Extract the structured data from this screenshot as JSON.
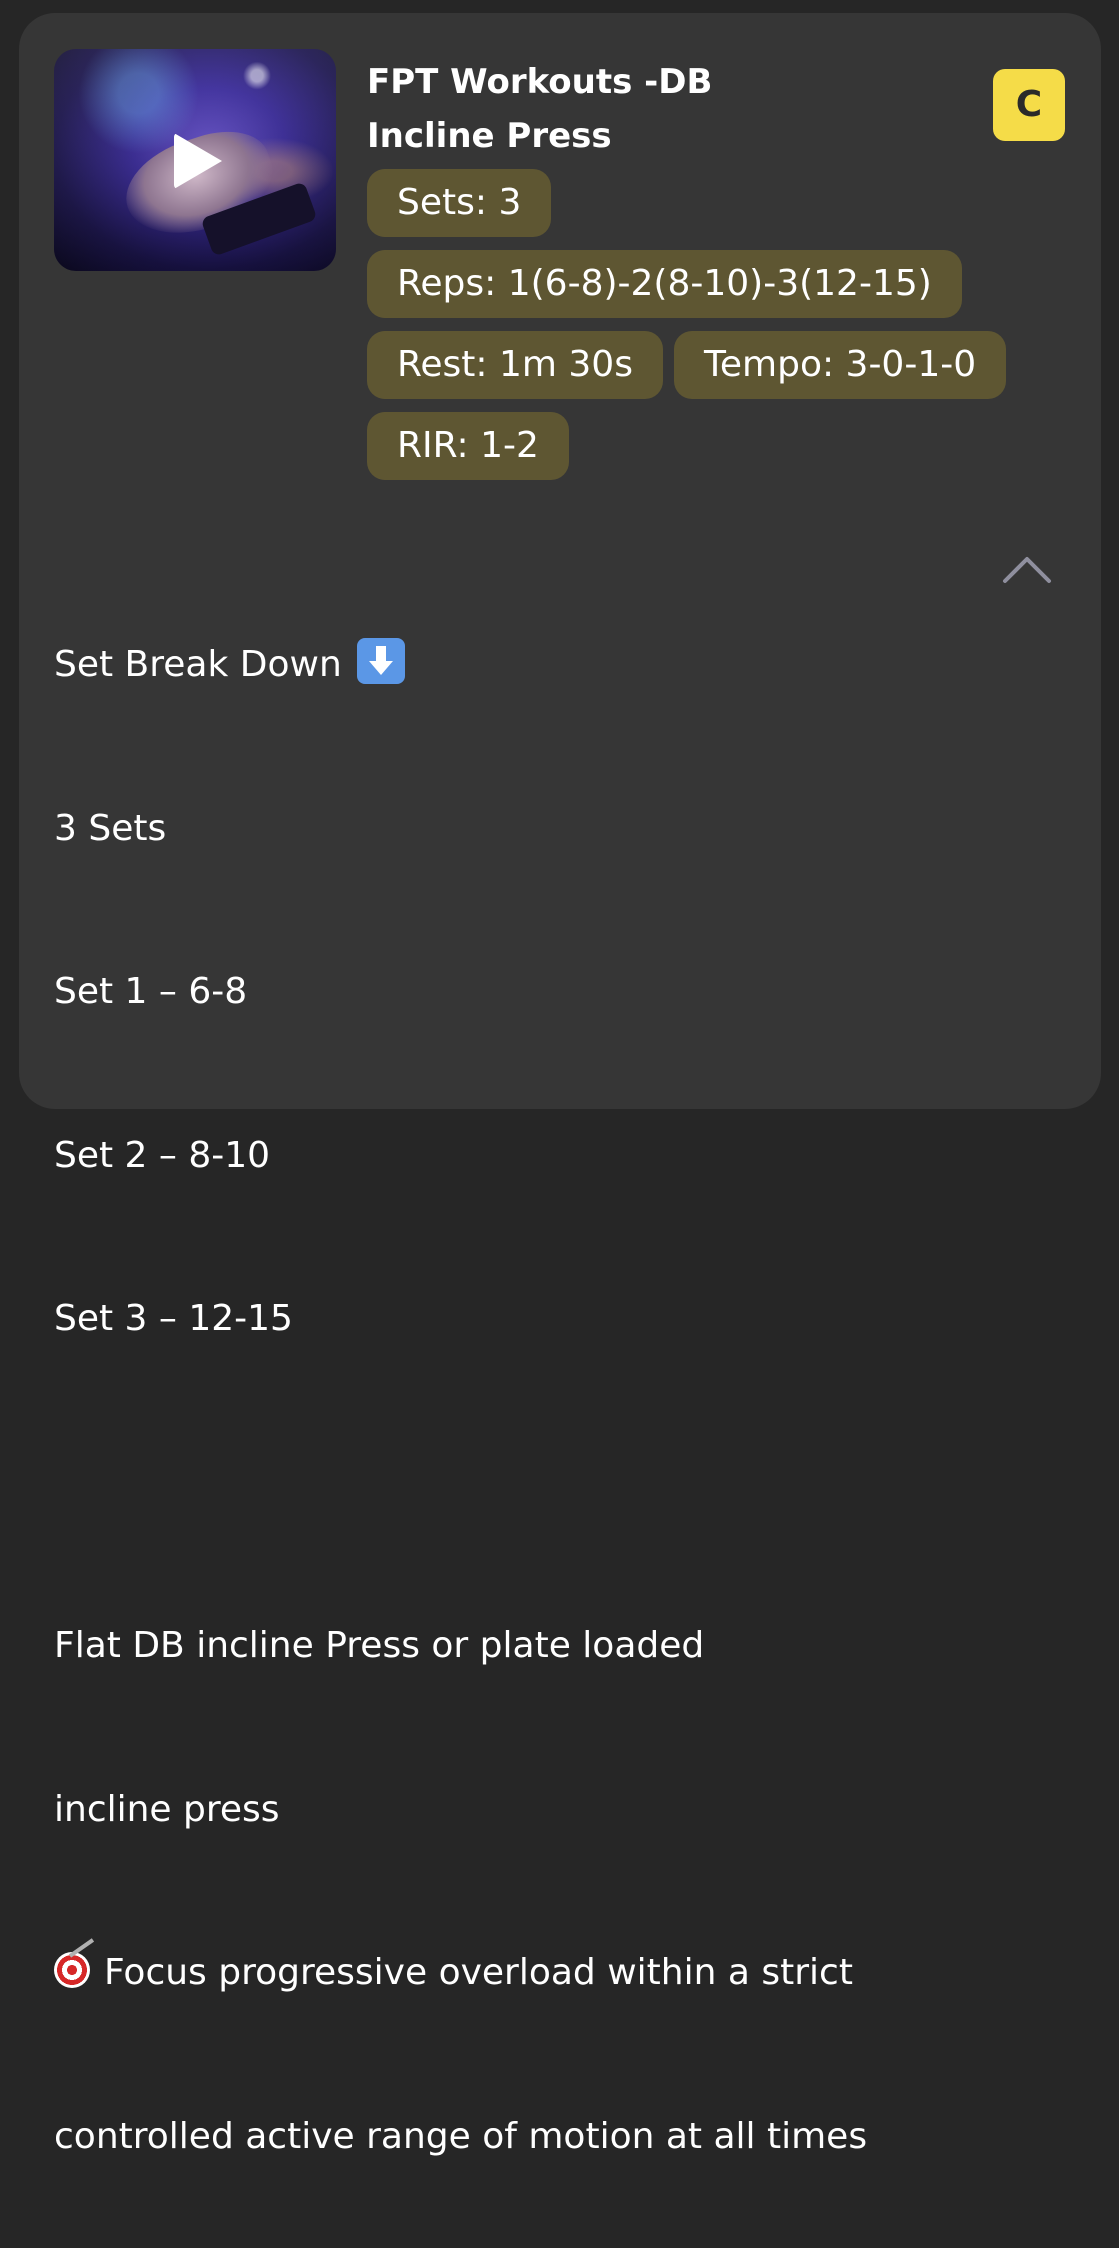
{
  "exercise": {
    "title_line1": "FPT Workouts -DB",
    "title_line2": "Incline Press",
    "grade": "C",
    "media": {
      "icon": "play-icon"
    }
  },
  "pills": {
    "sets": "Sets: 3",
    "reps": "Reps: 1(6-8)-2(8-10)-3(12-15)",
    "rest": "Rest: 1m 30s",
    "tempo": "Tempo: 3-0-1-0",
    "rir": "RIR: 1-2"
  },
  "description": {
    "heading": "Set Break Down",
    "heading_icon": "down-arrow-emoji-icon",
    "line1": "3 Sets",
    "line2": "Set 1 – 6-8",
    "line3": "Set 2 – 8-10",
    "line4": "Set 3 – 12-15",
    "line5": "Flat DB incline Press or plate loaded",
    "line6": "incline press",
    "line7_icon": "direct-hit-target-icon",
    "line7": "Focus progressive overload within a strict",
    "line8": "controlled active range of motion at all times"
  },
  "controls": {
    "collapse_icon": "chevron-up-icon"
  },
  "colors": {
    "card": "#363636",
    "pill": "#5e5632",
    "grade_badge": "#f5dc48",
    "text": "#ffffff"
  }
}
